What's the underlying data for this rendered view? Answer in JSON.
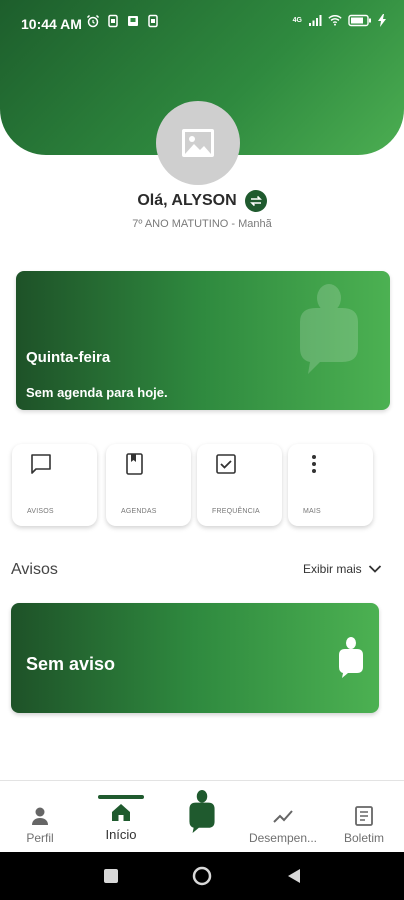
{
  "status_bar": {
    "time": "10:44 AM",
    "network_label": "4G",
    "left_icons": [
      "alarm-icon",
      "sim-icon",
      "notification-icon",
      "sim-icon"
    ],
    "right_icons": [
      "signal-icon",
      "wifi-icon",
      "battery-icon",
      "charging-icon"
    ]
  },
  "profile": {
    "greeting": "Olá, ALYSON",
    "class_info": "7º ANO MATUTINO - Manhã",
    "avatar_icon": "image-placeholder-icon",
    "switch_icon": "swap-icon"
  },
  "agenda": {
    "day": "Quinta-feira",
    "message": "Sem agenda para hoje."
  },
  "shortcuts": [
    {
      "label": "AVISOS",
      "icon": "chat-bubble-icon"
    },
    {
      "label": "AGENDAS",
      "icon": "book-icon"
    },
    {
      "label": "FREQUÊNCIA",
      "icon": "checkbox-icon"
    },
    {
      "label": "MAIS",
      "icon": "more-vertical-icon"
    }
  ],
  "avisos": {
    "title": "Avisos",
    "exibir_mais": "Exibir mais",
    "empty_message": "Sem aviso"
  },
  "bottom_nav": {
    "items": [
      {
        "label": "Perfil",
        "icon": "person-icon"
      },
      {
        "label": "Início",
        "icon": "home-icon",
        "active": true
      },
      {
        "label": "",
        "icon": "app-logo-icon"
      },
      {
        "label": "Desempen...",
        "icon": "trend-icon"
      },
      {
        "label": "Boletim",
        "icon": "report-icon"
      }
    ]
  },
  "colors": {
    "primary_dark": "#1f5a2e",
    "primary_light": "#4cae52"
  }
}
